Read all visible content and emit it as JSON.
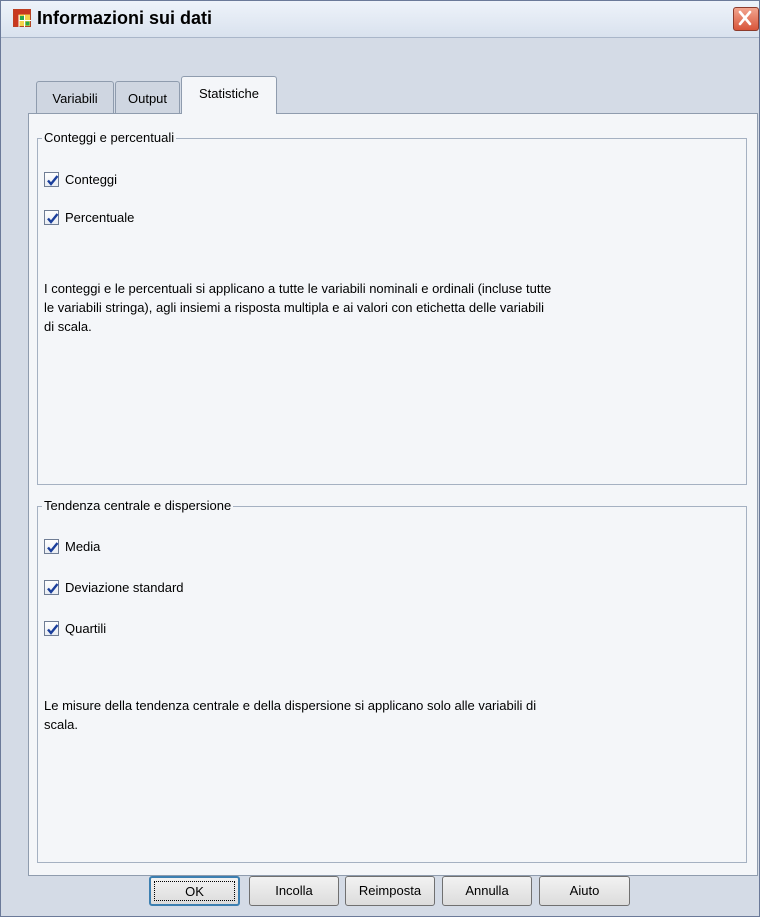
{
  "window": {
    "title": "Informazioni sui dati"
  },
  "tabs": [
    {
      "label": "Variabili",
      "active": false
    },
    {
      "label": "Output",
      "active": false
    },
    {
      "label": "Statistiche",
      "active": true
    }
  ],
  "group_counts": {
    "legend": "Conteggi e percentuali",
    "checkboxes": [
      {
        "label": "Conteggi",
        "checked": true
      },
      {
        "label": "Percentuale",
        "checked": true
      }
    ],
    "description_lines": [
      "I conteggi e le percentuali si applicano a tutte le variabili nominali e ordinali (incluse tutte",
      "le variabili stringa), agli insiemi a risposta multipla e ai valori con etichetta delle variabili",
      "di scala."
    ]
  },
  "group_central": {
    "legend": "Tendenza centrale e dispersione",
    "checkboxes": [
      {
        "label": "Media",
        "checked": true
      },
      {
        "label": "Deviazione standard",
        "checked": true
      },
      {
        "label": "Quartili",
        "checked": true
      }
    ],
    "description_lines": [
      "Le misure della tendenza centrale e della dispersione si applicano solo alle variabili di",
      "scala."
    ]
  },
  "buttons": {
    "ok": "OK",
    "paste": "Incolla",
    "reset": "Reimposta",
    "cancel": "Annulla",
    "help": "Aiuto"
  },
  "colors": {
    "check_mark": "#1b3f9c",
    "close_button": "#d8553a",
    "tab_panel": "#f4f6f9"
  },
  "icons": {
    "app": "data-grid-icon",
    "close": "close-icon",
    "check": "checkmark-icon"
  }
}
